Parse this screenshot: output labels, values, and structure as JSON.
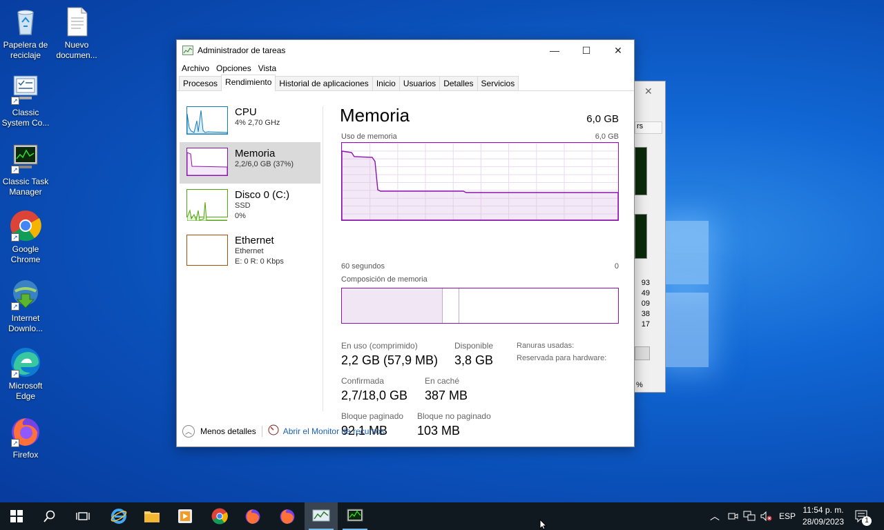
{
  "desktop": {
    "icons": [
      {
        "label": "Papelera de reciclaje"
      },
      {
        "label": "Nuevo documen..."
      },
      {
        "label": "Classic System Co..."
      },
      {
        "label": "Classic Task Manager"
      },
      {
        "label": "Google Chrome"
      },
      {
        "label": "Internet Downlo..."
      },
      {
        "label": "Microsoft Edge"
      },
      {
        "label": "Firefox"
      }
    ]
  },
  "window": {
    "title": "Administrador de tareas",
    "minimize": "—",
    "maximize": "☐",
    "close": "✕",
    "menu": [
      "Archivo",
      "Opciones",
      "Vista"
    ],
    "tabs": [
      "Procesos",
      "Rendimiento",
      "Historial de aplicaciones",
      "Inicio",
      "Usuarios",
      "Detalles",
      "Servicios"
    ],
    "active_tab": "Rendimiento"
  },
  "resources": [
    {
      "name": "CPU",
      "line1": "4%  2,70 GHz",
      "line2": "",
      "color": "#117dbb"
    },
    {
      "name": "Memoria",
      "line1": "2,2/6,0 GB (37%)",
      "line2": "",
      "color": "#8b12ae"
    },
    {
      "name": "Disco 0 (C:)",
      "line1": "SSD",
      "line2": "0%",
      "color": "#4da60c"
    },
    {
      "name": "Ethernet",
      "line1": "Ethernet",
      "line2": "E: 0  R: 0 Kbps",
      "color": "#a74f01"
    }
  ],
  "memory": {
    "title": "Memoria",
    "total": "6,0 GB",
    "usage_label": "Uso de memoria",
    "usage_max": "6,0 GB",
    "time_left": "60 segundos",
    "time_right": "0",
    "composition_label": "Composición de memoria",
    "stats": {
      "in_use_label": "En uso (comprimido)",
      "in_use_value": "2,2 GB (57,9 MB)",
      "available_label": "Disponible",
      "available_value": "3,8 GB",
      "committed_label": "Confirmada",
      "committed_value": "2,7/18,0 GB",
      "cached_label": "En caché",
      "cached_value": "387 MB",
      "paged_label": "Bloque paginado",
      "paged_value": "92,1 MB",
      "nonpaged_label": "Bloque no paginado",
      "nonpaged_value": "103 MB",
      "slots_label": "Ranuras usadas:",
      "reserved_label": "Reservada para hardware:"
    }
  },
  "footer": {
    "less_details": "Menos detalles",
    "resource_monitor": "Abrir el Monitor de recursos"
  },
  "background_window": {
    "partial_tab": "rs",
    "values": [
      "93",
      "49",
      "09",
      "38",
      "17"
    ],
    "pct": "%"
  },
  "taskbar": {
    "language": "ESP",
    "time": "11:54 p. m.",
    "date": "28/09/2023",
    "notifications": "1"
  }
}
